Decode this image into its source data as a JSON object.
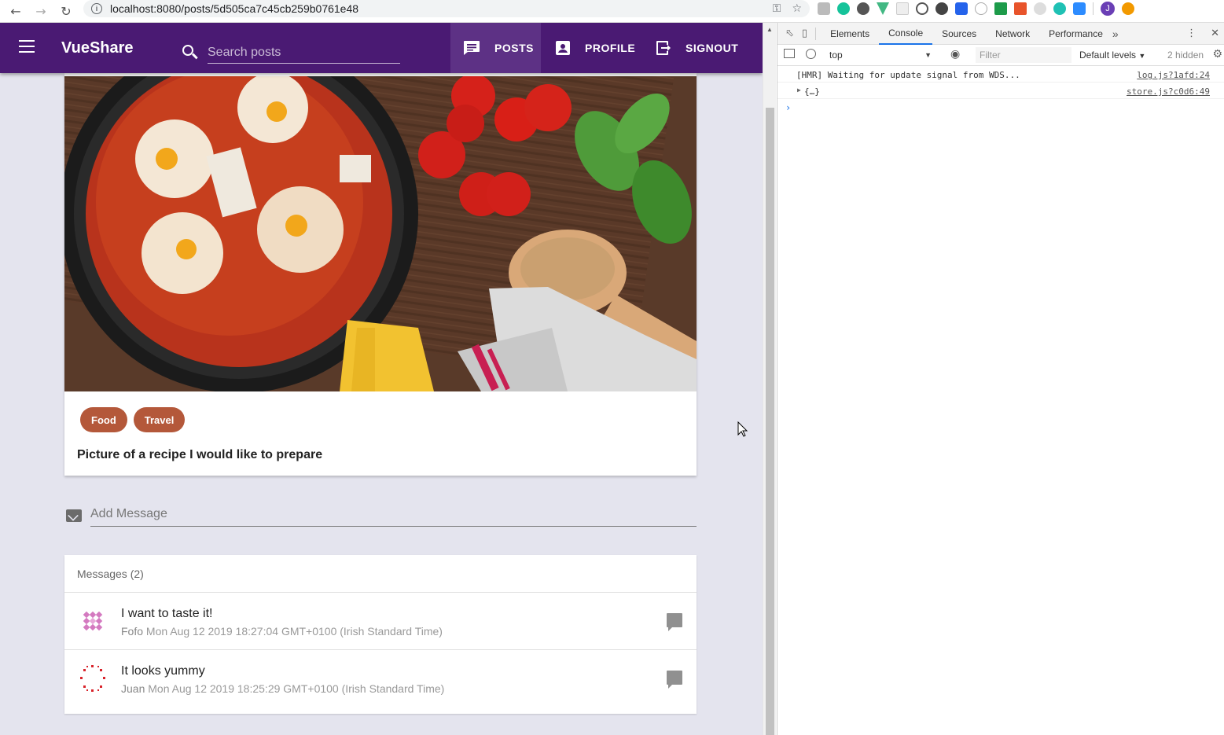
{
  "browser": {
    "url": "localhost:8080/posts/5d505ca7c45cb259b0761e48",
    "profile_initial": "J"
  },
  "app": {
    "brand": "VueShare",
    "search_placeholder": "Search posts",
    "nav": [
      {
        "label": "POSTS",
        "icon": "chat-icon",
        "active": true
      },
      {
        "label": "PROFILE",
        "icon": "account-box-icon",
        "active": false
      },
      {
        "label": "SIGNOUT",
        "icon": "exit-icon",
        "active": false
      }
    ],
    "colors": {
      "toolbar": "#4a1a73",
      "chip": "#b4583a",
      "background": "#e4e4ee"
    }
  },
  "post": {
    "categories": [
      "Food",
      "Travel"
    ],
    "title": "Picture of a recipe I would like to prepare"
  },
  "message_input": {
    "placeholder": "Add Message"
  },
  "messages": {
    "header": "Messages (2)",
    "items": [
      {
        "text": "I want to taste it!",
        "author": "Fofo",
        "date": "Mon Aug 12 2019 18:27:04 GMT+0100 (Irish Standard Time)"
      },
      {
        "text": "It looks yummy",
        "author": "Juan",
        "date": "Mon Aug 12 2019 18:25:29 GMT+0100 (Irish Standard Time)"
      }
    ]
  },
  "devtools": {
    "tabs": [
      "Elements",
      "Console",
      "Sources",
      "Network",
      "Performance"
    ],
    "active_tab": "Console",
    "context": "top",
    "filter_placeholder": "Filter",
    "levels": "Default levels",
    "hidden": "2 hidden",
    "console": [
      {
        "message": "[HMR] Waiting for update signal from WDS...",
        "source": "log.js?1afd:24"
      },
      {
        "message": "{…}",
        "source": "store.js?c0d6:49"
      }
    ]
  }
}
